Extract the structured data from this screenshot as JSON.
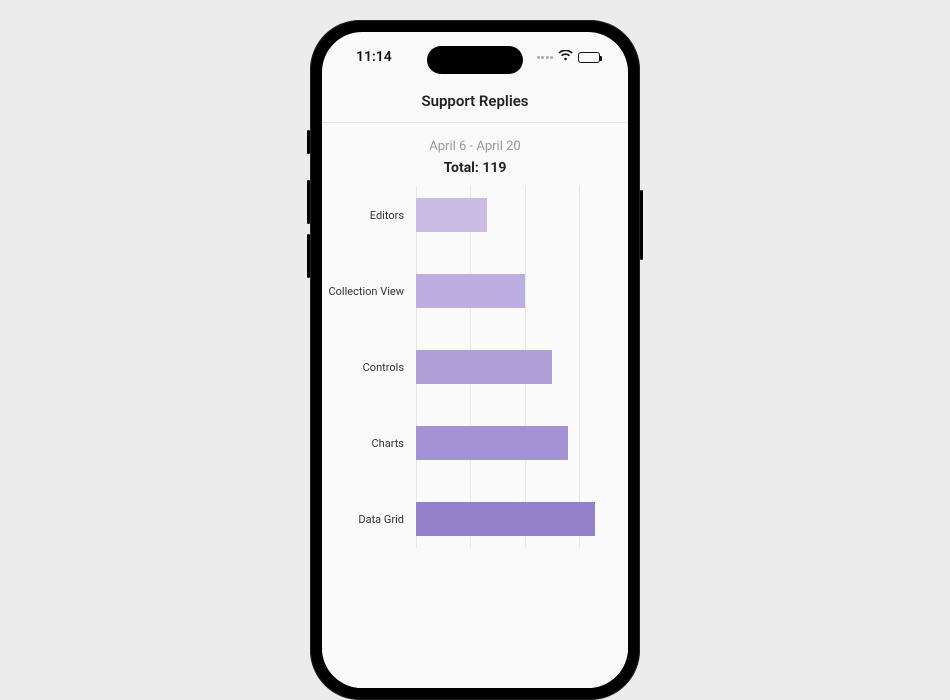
{
  "status": {
    "time": "11:14"
  },
  "header": {
    "title": "Support Replies"
  },
  "summary": {
    "date_range": "April 6 - April 20",
    "total_label": "Total: 119"
  },
  "chart_data": {
    "type": "bar",
    "orientation": "horizontal",
    "categories": [
      "Editors",
      "Collection View",
      "Controls",
      "Charts",
      "Data Grid"
    ],
    "values": [
      13,
      20,
      25,
      28,
      33
    ],
    "colors": [
      "#c9bde6",
      "#bcaee0",
      "#b0a0da",
      "#a493d4",
      "#9481cb"
    ],
    "title": "Support Replies",
    "xlabel": "",
    "ylabel": "",
    "xlim": [
      0,
      35
    ],
    "grid_ticks": [
      0,
      10,
      20,
      30
    ]
  }
}
